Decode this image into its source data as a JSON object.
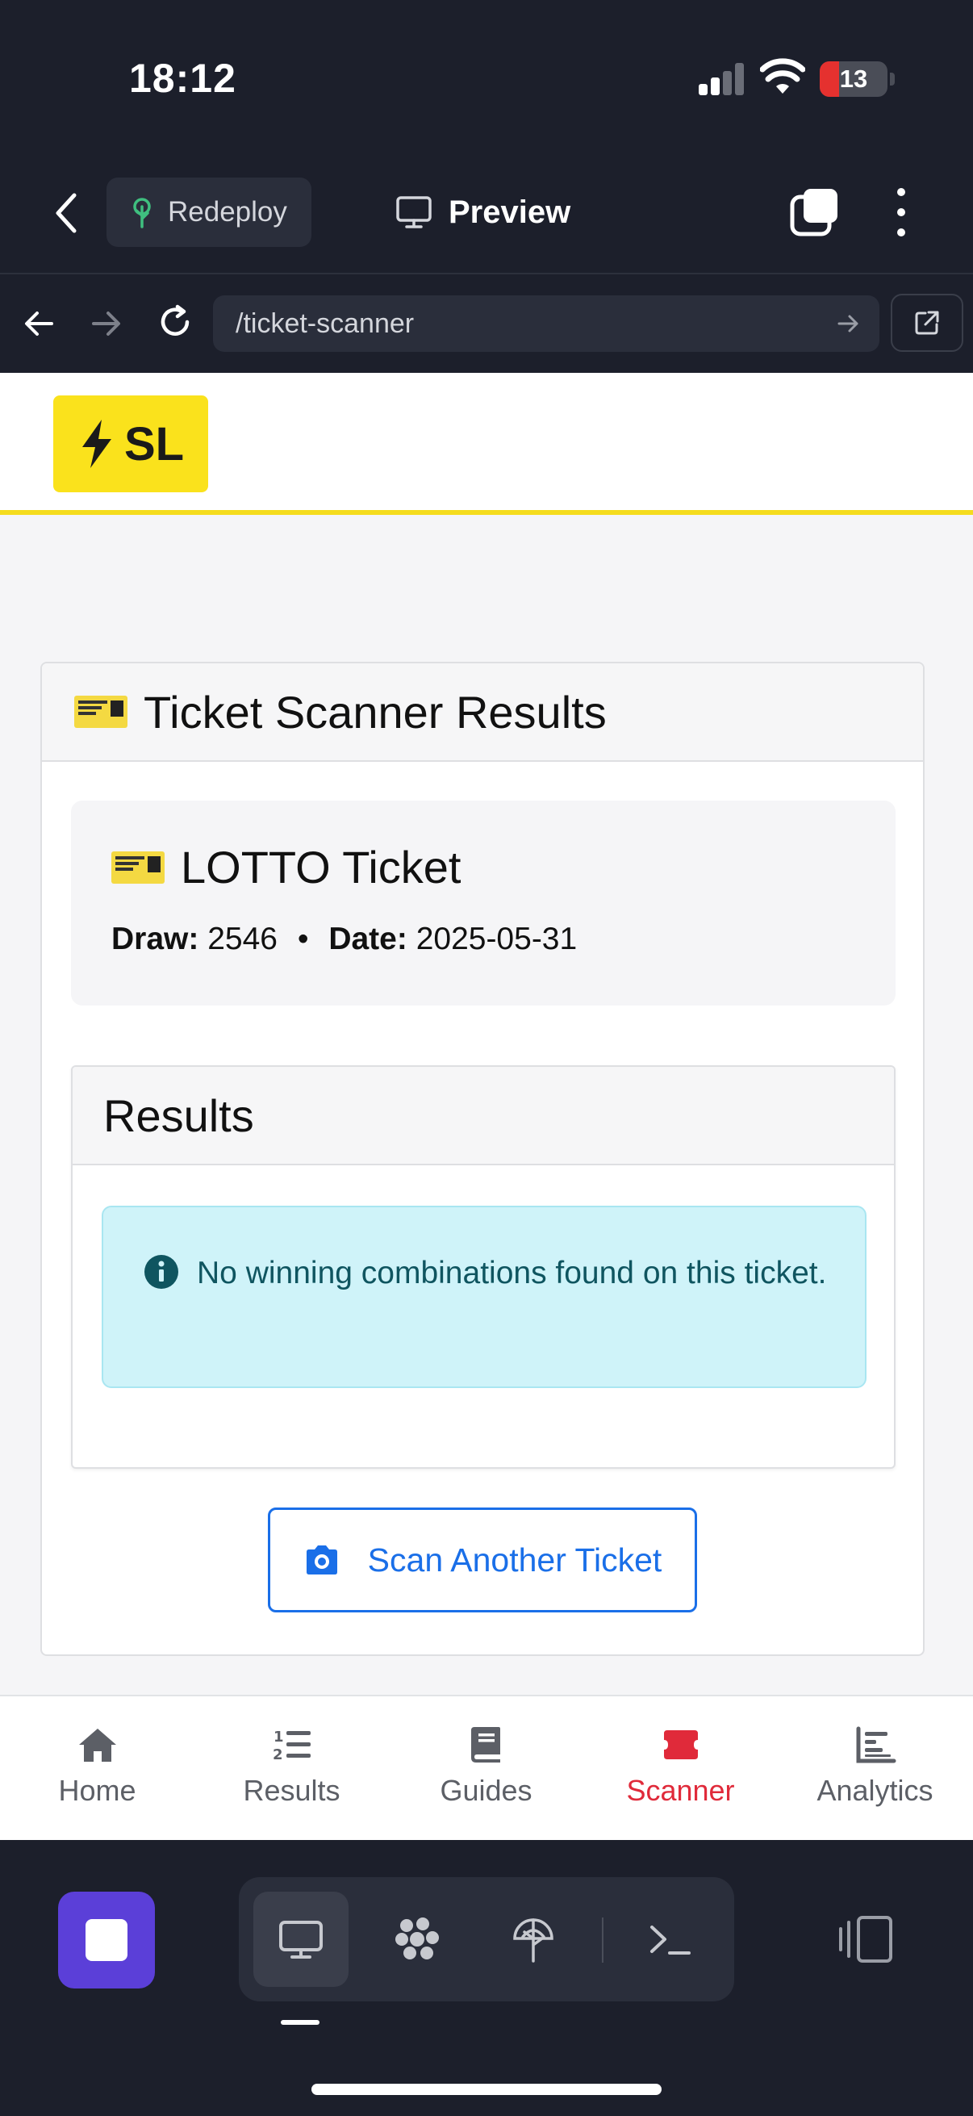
{
  "status_bar": {
    "time": "18:12",
    "battery": "13",
    "battery_fraction": 0.13,
    "signal_bars": 2,
    "icons": [
      "signal-icon",
      "wifi-icon",
      "battery-icon"
    ]
  },
  "top_bar": {
    "redeploy_label": "Redeploy",
    "preview_label": "Preview",
    "icons": [
      "back-chevron-icon",
      "redeploy-tree-icon",
      "monitor-icon",
      "tabs-icon",
      "more-vertical-icon"
    ]
  },
  "url_bar": {
    "url": "/ticket-scanner",
    "icons": [
      "back-arrow-icon",
      "forward-arrow-icon",
      "reload-icon",
      "go-arrow-icon",
      "open-external-icon"
    ]
  },
  "site": {
    "logo_text": "SL",
    "logo_icon": "bolt-icon",
    "brand_color": "#fae21c"
  },
  "scanner_card": {
    "title": "Ticket Scanner Results",
    "ticket": {
      "title": "LOTTO Ticket",
      "draw_label": "Draw:",
      "draw_value": "2546",
      "separator": "•",
      "date_label": "Date:",
      "date_value": "2025-05-31"
    },
    "results": {
      "heading": "Results",
      "alert_text": "No winning combinations found on this ticket.",
      "alert_icon": "info-circle-icon"
    },
    "scan_button_label": "Scan Another Ticket",
    "scan_button_icon": "camera-icon",
    "accent_color": "#1a6fe8"
  },
  "bottom_nav": {
    "active": "Scanner",
    "active_color": "#e02a3a",
    "items": [
      {
        "label": "Home",
        "icon": "home-icon"
      },
      {
        "label": "Results",
        "icon": "numbered-list-icon"
      },
      {
        "label": "Guides",
        "icon": "book-icon"
      },
      {
        "label": "Scanner",
        "icon": "ticket-icon"
      },
      {
        "label": "Analytics",
        "icon": "bar-chart-icon"
      }
    ]
  },
  "app_toolbar": {
    "stop_color": "#5b3fd8",
    "icons": [
      "stop-icon",
      "desktop-icon",
      "agent-icon",
      "deploy-icon",
      "terminal-icon",
      "side-panel-icon"
    ]
  }
}
